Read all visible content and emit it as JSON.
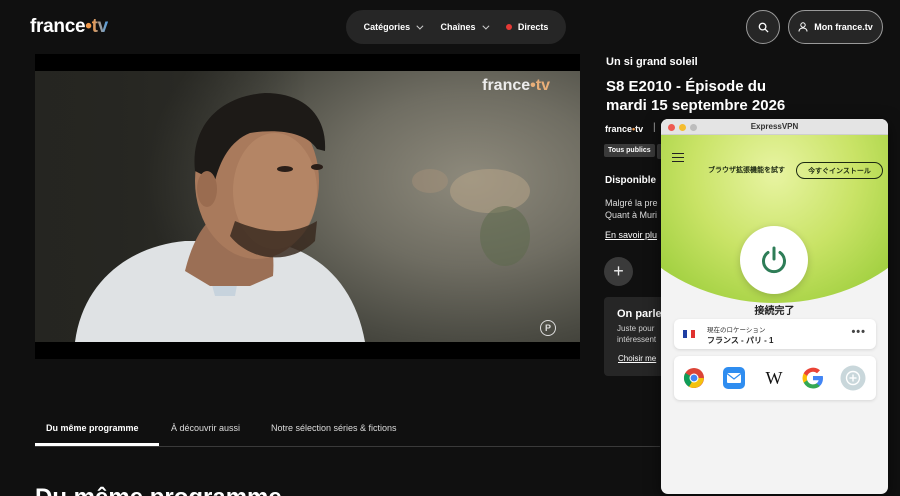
{
  "header": {
    "logo": {
      "part1": "france",
      "dot": "•",
      "part2": "tv"
    },
    "nav": {
      "categories": "Catégories",
      "channels": "Chaînes",
      "live": "Directs"
    },
    "profile_label": "Mon france.tv",
    "icons": {
      "search": "search-icon",
      "user": "user-icon"
    }
  },
  "player": {
    "watermark": {
      "part1": "france",
      "dot": "•",
      "part2": "tv"
    },
    "rating_badge": "P"
  },
  "info": {
    "show_title": "Un si grand soleil",
    "episode_title": "S8 E2010 - Épisode du mardi 15 septembre 2026",
    "channel_logo": {
      "part1": "france",
      "dot": "•",
      "part2": "tv"
    },
    "separator": "|",
    "audience_tag": "Tous publics",
    "availability": "Disponible",
    "synopsis": "Malgré la pre\nQuant à Muri",
    "more_link": "En savoir plu",
    "add_button": "+",
    "comments": {
      "title": "On parle",
      "text": "Juste pour\nintéressent",
      "link": "Choisir me"
    }
  },
  "tabs": [
    {
      "label": "Du même programme",
      "active": true
    },
    {
      "label": "À découvrir aussi",
      "active": false
    },
    {
      "label": "Notre sélection séries & fictions",
      "active": false
    }
  ],
  "section_heading": "Du même programme",
  "vpn": {
    "window_title": "ExpressVPN",
    "extension_text": "ブラウザ拡張機能を試す",
    "install_button": "今すぐインストール",
    "status": "接続完了",
    "location_label": "現在のロケーション",
    "location_name": "フランス - パリ - 1",
    "more_icon": "•••",
    "colors": {
      "accent_green": "#9fcf3e",
      "power_green": "#2e7d57"
    },
    "shortcuts": [
      "chrome-icon",
      "mail-icon",
      "wikipedia-icon",
      "google-icon",
      "add-shortcut-icon"
    ],
    "wikipedia_glyph": "W"
  },
  "colors": {
    "background": "#101010",
    "live_dot": "#e53935",
    "brand_orange": "#f2994a",
    "brand_blue": "#4f9fe6"
  }
}
